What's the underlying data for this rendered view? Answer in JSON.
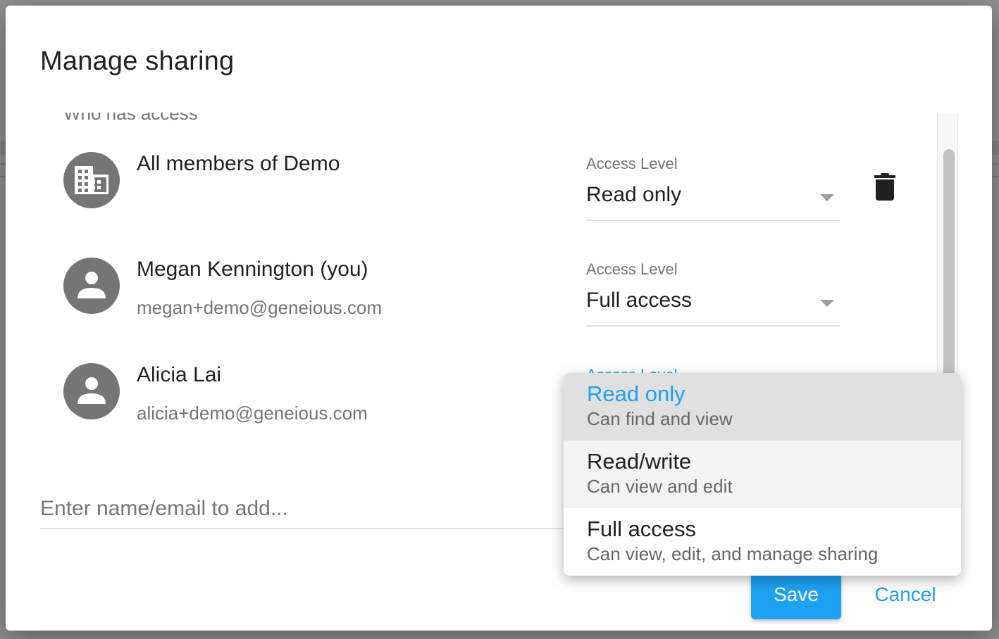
{
  "dialog": {
    "title": "Manage sharing",
    "section_label": "Who has access"
  },
  "members": [
    {
      "name": "All members of Demo",
      "email": "",
      "avatar_icon": "building-icon",
      "access_label": "Access Level",
      "access_value": "Read only",
      "deletable": true
    },
    {
      "name": "Megan Kennington (you)",
      "email": "megan+demo@geneious.com",
      "avatar_icon": "person-icon",
      "access_label": "Access Level",
      "access_value": "Full access",
      "deletable": false
    },
    {
      "name": "Alicia Lai",
      "email": "alicia+demo@geneious.com",
      "avatar_icon": "person-icon",
      "access_label": "Access Level",
      "access_value": "Read only",
      "deletable": false
    }
  ],
  "add_input": {
    "value": "",
    "placeholder": "Enter name/email to add..."
  },
  "dropdown": {
    "open_for_member": 2,
    "options": [
      {
        "title": "Read only",
        "description": "Can find and view",
        "state": "selected"
      },
      {
        "title": "Read/write",
        "description": "Can view and edit",
        "state": "hover"
      },
      {
        "title": "Full access",
        "description": "Can view, edit, and manage sharing",
        "state": "normal"
      }
    ]
  },
  "actions": {
    "save_label": "Save",
    "cancel_label": "Cancel"
  },
  "colors": {
    "accent": "#1da1f2",
    "avatar_bg": "#757575",
    "primary_text": "#212121",
    "secondary_text": "#757575",
    "selected_item_bg": "#e0e0e0",
    "hover_item_bg": "#f4f4f4"
  },
  "icons": {
    "delete": "trash-icon",
    "caret": "caret-down-icon"
  }
}
